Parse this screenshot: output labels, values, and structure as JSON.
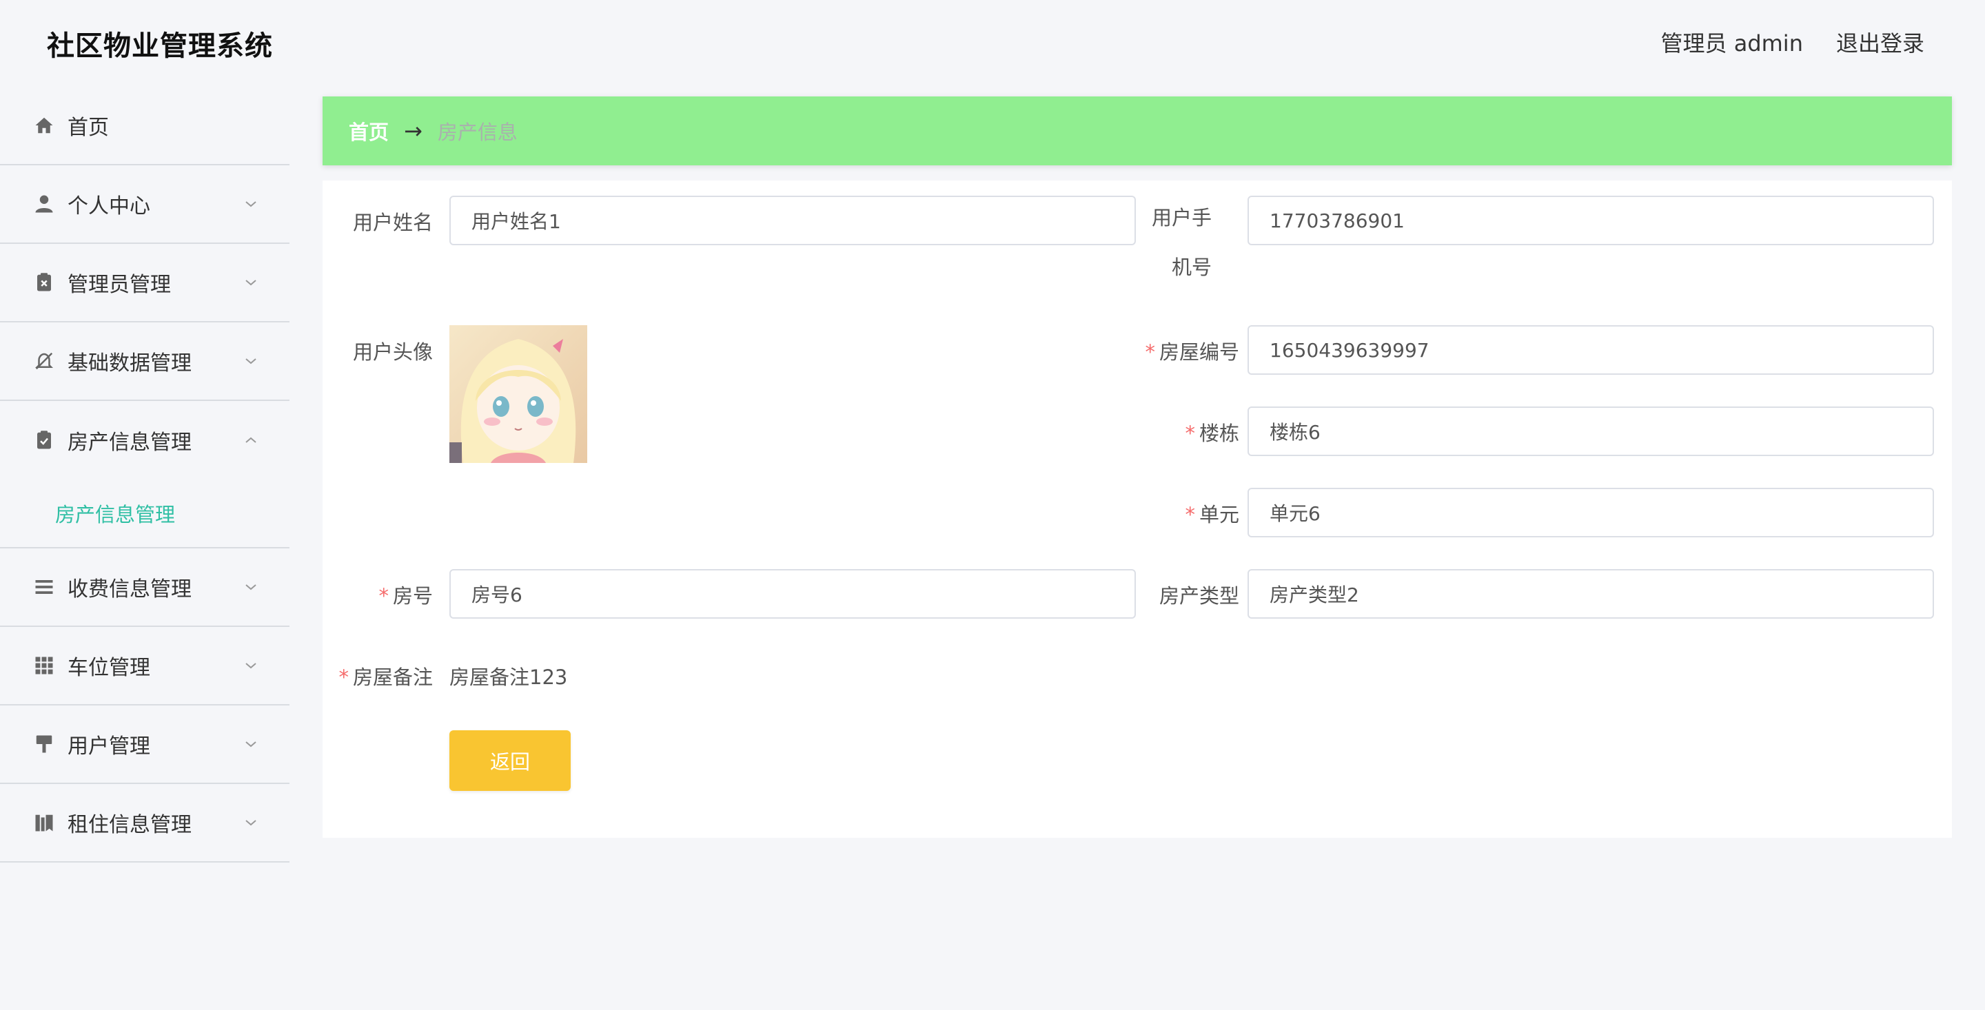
{
  "app": {
    "title": "社区物业管理系统"
  },
  "header": {
    "user_label": "管理员 admin",
    "logout_label": "退出登录"
  },
  "sidebar": {
    "items": [
      {
        "label": "首页",
        "icon": "home-icon"
      },
      {
        "label": "个人中心",
        "icon": "user-icon"
      },
      {
        "label": "管理员管理",
        "icon": "clipboard-x-icon"
      },
      {
        "label": "基础数据管理",
        "icon": "bell-off-icon"
      },
      {
        "label": "房产信息管理",
        "icon": "clipboard-check-icon",
        "expanded": true,
        "children": [
          {
            "label": "房产信息管理"
          }
        ]
      },
      {
        "label": "收费信息管理",
        "icon": "list-icon"
      },
      {
        "label": "车位管理",
        "icon": "grid-icon"
      },
      {
        "label": "用户管理",
        "icon": "brush-icon"
      },
      {
        "label": "租住信息管理",
        "icon": "books-icon"
      }
    ],
    "active_color": "#2fbfa4"
  },
  "breadcrumb": {
    "home": "首页",
    "separator": "→",
    "current": "房产信息"
  },
  "form": {
    "username": {
      "label": "用户姓名",
      "value": "用户姓名1"
    },
    "phone": {
      "label": "用户手机号",
      "value": "17703786901"
    },
    "avatar": {
      "label": "用户头像"
    },
    "house_no": {
      "label": "房屋编号",
      "value": "1650439639997",
      "required": true
    },
    "building": {
      "label": "楼栋",
      "value": "楼栋6",
      "required": true
    },
    "unit": {
      "label": "单元",
      "value": "单元6",
      "required": true
    },
    "room": {
      "label": "房号",
      "value": "房号6",
      "required": true
    },
    "property_type": {
      "label": "房产类型",
      "value": "房产类型2"
    },
    "remark": {
      "label": "房屋备注",
      "value": "房屋备注123",
      "required": true
    },
    "back_button": "返回"
  },
  "colors": {
    "breadcrumb_bg": "#90ee90",
    "button_bg": "#f9c531",
    "required": "#f56c6c"
  }
}
